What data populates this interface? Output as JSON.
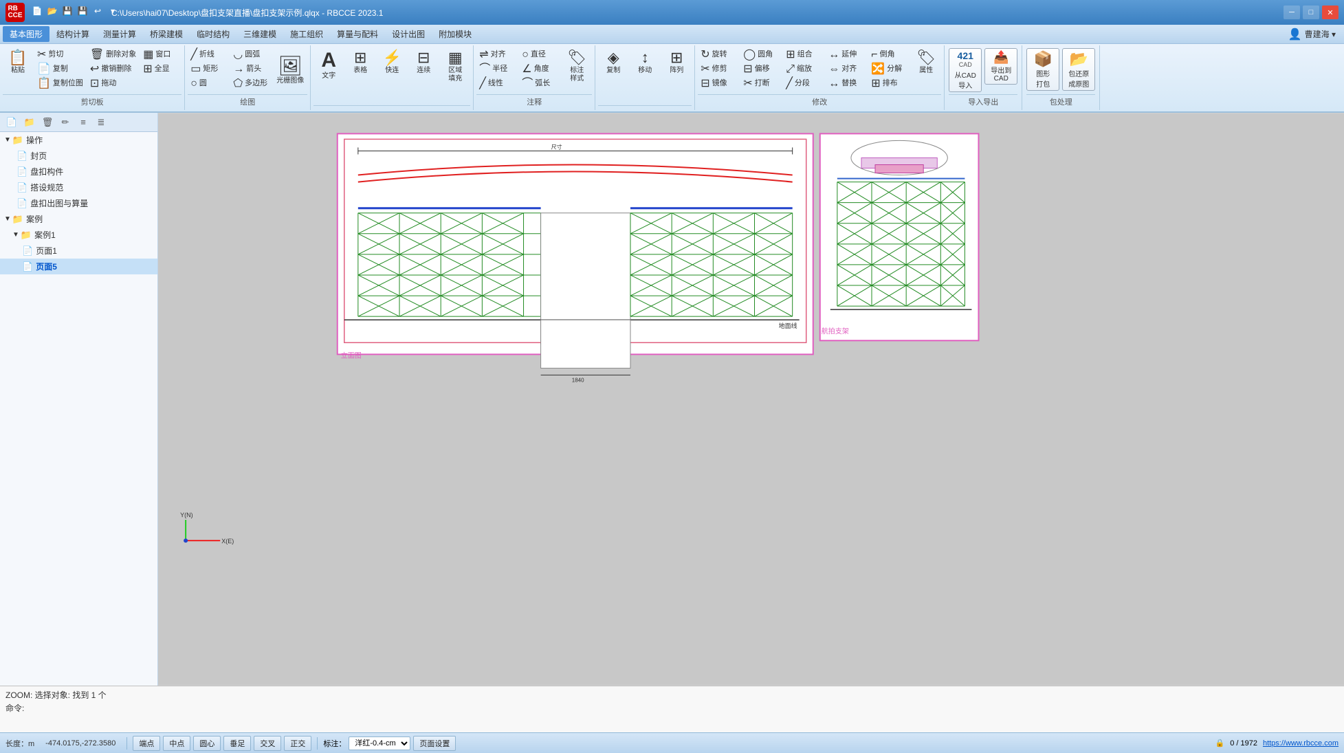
{
  "app": {
    "logo_line1": "RB",
    "logo_line2": "CCE",
    "title": "C:\\Users\\hai07\\Desktop\\盘扣支架直播\\盘扣支架示例.qlqx - RBCCE 2023.1",
    "win_minimize": "─",
    "win_restore": "□",
    "win_close": "✕"
  },
  "quickaccess": {
    "buttons": [
      "📄",
      "💾",
      "💾",
      "↩",
      "▾"
    ]
  },
  "menubar": {
    "items": [
      "基本图形",
      "结构计算",
      "测量计算",
      "桥梁建模",
      "临时结构",
      "三维建模",
      "施工组织",
      "算量与配料",
      "设计出图",
      "附加模块"
    ],
    "active_index": 0
  },
  "user": {
    "label": "曹建海 ▾"
  },
  "ribbon": {
    "groups": [
      {
        "label": "剪切板",
        "buttons": [
          {
            "icon": "📋",
            "text": "粘贴",
            "size": "large"
          },
          {
            "icon": "✂",
            "text": "剪切",
            "size": "small"
          },
          {
            "icon": "📄",
            "text": "复制",
            "size": "small"
          },
          {
            "icon": "🗑",
            "text": "删除对象",
            "size": "small"
          },
          {
            "icon": "↩",
            "text": "撤销删除",
            "size": "small"
          },
          {
            "icon": "▦",
            "text": "窗口",
            "size": "small"
          },
          {
            "icon": "⊞",
            "text": "全显",
            "size": "small"
          },
          {
            "icon": "📋",
            "text": "复制位图",
            "size": "small"
          },
          {
            "icon": "⊡",
            "text": "拖动",
            "size": "small"
          }
        ]
      },
      {
        "label": "绘图",
        "buttons": [
          {
            "icon": "╱",
            "text": "折线",
            "size": "small"
          },
          {
            "icon": "▭",
            "text": "矩形",
            "size": "small"
          },
          {
            "icon": "○",
            "text": "圆",
            "size": "small"
          },
          {
            "icon": "◡",
            "text": "圆弧",
            "size": "small"
          },
          {
            "icon": "→",
            "text": "箭头",
            "size": "small"
          },
          {
            "icon": "⬠",
            "text": "多边形",
            "size": "small"
          },
          {
            "icon": "▦",
            "text": "光栅图像",
            "size": "small"
          }
        ]
      },
      {
        "label": "",
        "buttons": [
          {
            "icon": "A",
            "text": "文字",
            "size": "large"
          },
          {
            "icon": "⊞",
            "text": "表格",
            "size": "large"
          },
          {
            "icon": "⚡",
            "text": "快连",
            "size": "large"
          },
          {
            "icon": "⊟",
            "text": "连续",
            "size": "large"
          },
          {
            "icon": "▦",
            "text": "区域填充",
            "size": "large"
          }
        ]
      },
      {
        "label": "注释",
        "buttons": [
          {
            "icon": "⇌",
            "text": "对齐",
            "size": "small"
          },
          {
            "icon": "⌒",
            "text": "半径",
            "size": "small"
          },
          {
            "icon": "╱",
            "text": "线性",
            "size": "small"
          },
          {
            "icon": "○",
            "text": "直径",
            "size": "small"
          },
          {
            "icon": "∠",
            "text": "角度",
            "size": "small"
          },
          {
            "icon": "⌒",
            "text": "弧长",
            "size": "small"
          },
          {
            "icon": "🏷",
            "text": "标注样式",
            "size": "large"
          }
        ]
      },
      {
        "label": "",
        "buttons": [
          {
            "icon": "◈",
            "text": "复制",
            "size": "large"
          },
          {
            "icon": "↕",
            "text": "移动",
            "size": "large"
          },
          {
            "icon": "⊞",
            "text": "阵列",
            "size": "large"
          }
        ]
      },
      {
        "label": "修改",
        "buttons": [
          {
            "icon": "↻",
            "text": "旋转",
            "size": "small"
          },
          {
            "icon": "✂",
            "text": "修剪",
            "size": "small"
          },
          {
            "icon": "◯",
            "text": "圆角",
            "size": "small"
          },
          {
            "icon": "⊟",
            "text": "偏移",
            "size": "small"
          },
          {
            "icon": "⊞",
            "text": "组合",
            "size": "small"
          },
          {
            "icon": "⤢",
            "text": "缩放",
            "size": "small"
          },
          {
            "icon": "↔",
            "text": "延伸",
            "size": "small"
          },
          {
            "icon": "⌐",
            "text": "倒角",
            "size": "small"
          },
          {
            "icon": "⇔",
            "text": "对齐",
            "size": "small"
          },
          {
            "icon": "🔀",
            "text": "分解",
            "size": "small"
          },
          {
            "icon": "⊟",
            "text": "镜像",
            "size": "small"
          },
          {
            "icon": "✂",
            "text": "打断",
            "size": "small"
          },
          {
            "icon": "╱",
            "text": "分段",
            "size": "small"
          },
          {
            "icon": "↔",
            "text": "替换",
            "size": "small"
          },
          {
            "icon": "⊞",
            "text": "排布",
            "size": "small"
          },
          {
            "icon": "🏷",
            "text": "属性",
            "size": "large"
          }
        ]
      },
      {
        "label": "导入导出",
        "cad_buttons": [
          {
            "num": "CAD",
            "sub": "CAD",
            "text": "从CAD\n导入",
            "icon": "📥"
          },
          {
            "num": "CAD",
            "sub": "CAD",
            "text": "导出到\nCAD",
            "icon": "📤"
          }
        ]
      },
      {
        "label": "包处理",
        "cad_buttons2": [
          {
            "text": "图形\n打包",
            "icon": "📦"
          },
          {
            "text": "包还原\n成原图",
            "icon": "📂"
          }
        ]
      }
    ],
    "cad_count": "421",
    "cad_unit": "CAD"
  },
  "sidebar": {
    "toolbar_buttons": [
      "📄",
      "📁",
      "🗑",
      "✏",
      "≡",
      "≣"
    ],
    "tree": [
      {
        "level": 0,
        "type": "group",
        "label": "操作",
        "expanded": true,
        "icon": "▼"
      },
      {
        "level": 1,
        "type": "item",
        "label": "封页",
        "icon": "📄"
      },
      {
        "level": 1,
        "type": "item",
        "label": "盘扣构件",
        "icon": "📄"
      },
      {
        "level": 1,
        "type": "item",
        "label": "搭设规范",
        "icon": "📄"
      },
      {
        "level": 1,
        "type": "item",
        "label": "盘扣出图与算量",
        "icon": "📄"
      },
      {
        "level": 0,
        "type": "group",
        "label": "案例",
        "expanded": true,
        "icon": "▼"
      },
      {
        "level": 1,
        "type": "group",
        "label": "案例1",
        "expanded": true,
        "icon": "▼"
      },
      {
        "level": 2,
        "type": "item",
        "label": "页面1",
        "icon": "📄"
      },
      {
        "level": 2,
        "type": "item",
        "label": "页面5",
        "icon": "📄",
        "selected": true
      }
    ]
  },
  "canvas": {
    "bg_color": "#d0d0d0",
    "frame1": {
      "label_bottom": "立面图",
      "label_top_inner": "地面线"
    },
    "frame2": {
      "label_bottom": "航拍支架"
    }
  },
  "cmdline": {
    "output_line1": "ZOOM: 选择对象: 找到 1 个",
    "prompt_label": "命令:",
    "input_value": ""
  },
  "statusbar": {
    "unit_label": "长度：m",
    "coords": "-474.0175,-272.3580",
    "snap_buttons": [
      "端点",
      "中点",
      "圆心",
      "垂足",
      "交叉",
      "正交"
    ],
    "label_label": "标注：",
    "label_value": "洋红-0.4-cm",
    "page_settings": "页面设置",
    "count": "0 / 1972",
    "website": "https://www.rbcce.com"
  }
}
